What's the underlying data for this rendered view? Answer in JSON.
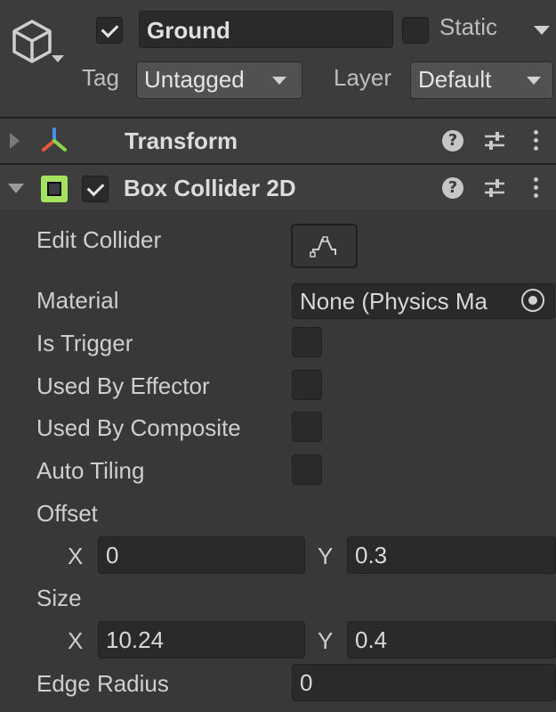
{
  "object": {
    "active": true,
    "name": "Ground",
    "static_label": "Static",
    "static_checked": false,
    "tag_label": "Tag",
    "tag_value": "Untagged",
    "layer_label": "Layer",
    "layer_value": "Default"
  },
  "components": [
    {
      "title": "Transform",
      "expanded": false,
      "icon": "transform-axes-icon"
    },
    {
      "title": "Box Collider 2D",
      "expanded": true,
      "enabled": true,
      "icon": "box-collider-2d-icon"
    }
  ],
  "box_collider": {
    "edit_collider_label": "Edit Collider",
    "material_label": "Material",
    "material_value": "None (Physics Ma",
    "is_trigger_label": "Is Trigger",
    "is_trigger": false,
    "used_by_effector_label": "Used By Effector",
    "used_by_effector": false,
    "used_by_composite_label": "Used By Composite",
    "used_by_composite": false,
    "auto_tiling_label": "Auto Tiling",
    "auto_tiling": false,
    "offset_label": "Offset",
    "offset": {
      "x_label": "X",
      "x": "0",
      "y_label": "Y",
      "y": "0.3"
    },
    "size_label": "Size",
    "size": {
      "x_label": "X",
      "x": "10.24",
      "y_label": "Y",
      "y": "0.4"
    },
    "edge_radius_label": "Edge Radius",
    "edge_radius": "0"
  },
  "colors": {
    "background": "#383838",
    "field": "#2a2a2a",
    "collider_icon": "#a5e35f",
    "transform_x": "#e8573b",
    "transform_y": "#8bd64a",
    "transform_z": "#4b8ee8"
  }
}
